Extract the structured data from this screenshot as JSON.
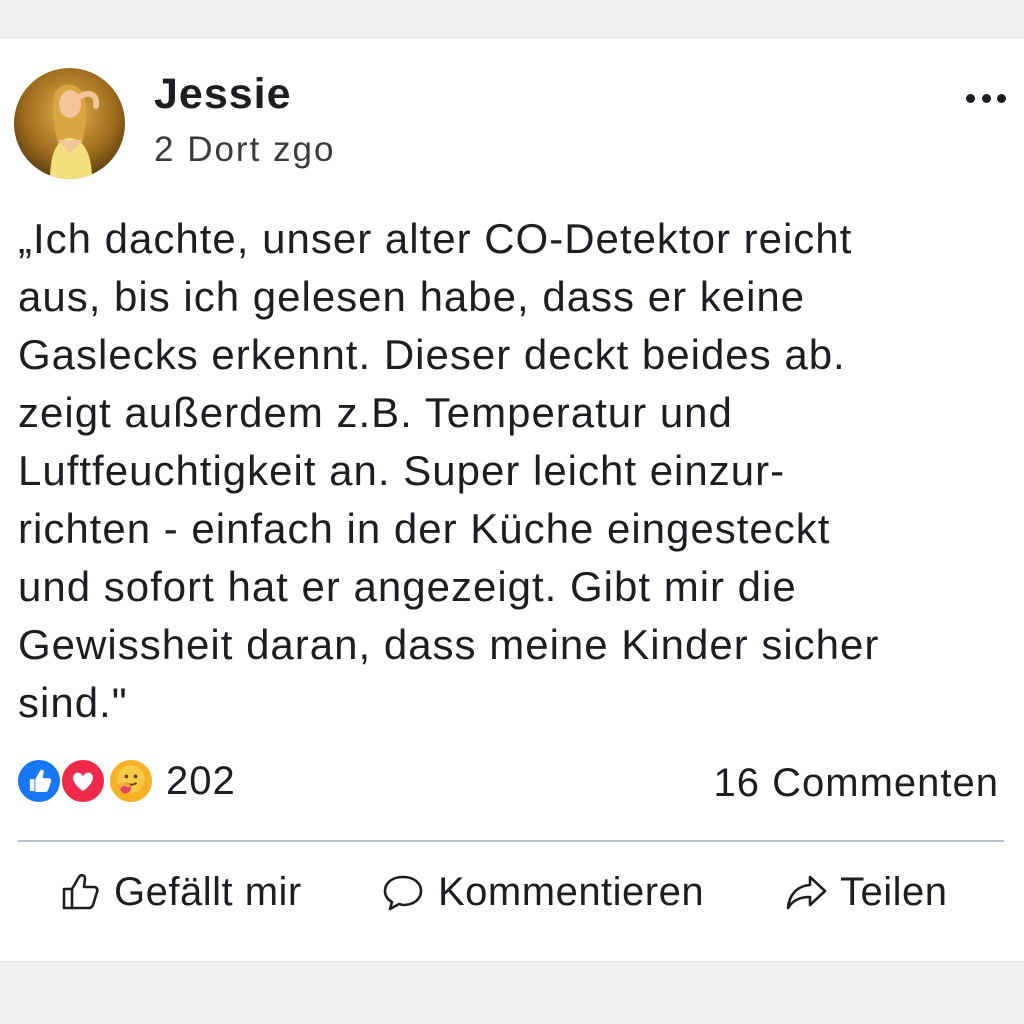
{
  "post": {
    "author": "Jessie",
    "timestamp": "2 Dort zgo",
    "text": "„Ich dachte, unser alter CO-Detektor reicht\naus, bis ich gelesen habe, dass er keine\nGaslecks erkennt. Dieser deckt beides ab.\nzeigt außerdem z.B. Temperatur und\nLuftfeuchtigkeit an. Super leicht einzur-\nrichten - einfach in der Küche eingesteckt\nund sofort hat er angezeigt. Gibt mir die\nGewissheit daran, dass meine Kinder sicher\nsind.\""
  },
  "reactions": {
    "icons": [
      "like-icon",
      "love-icon",
      "care-icon"
    ],
    "count": "202"
  },
  "comments": {
    "label": "16 Commenten"
  },
  "actions": {
    "like_label": "Gefällt mir",
    "comment_label": "Kommentieren",
    "share_label": "Teilen"
  },
  "colors": {
    "like_blue": "#1877f2",
    "love_red": "#f02849",
    "care_yellow": "#f7b125",
    "text": "#1c1e21",
    "divider": "#b9c3cf"
  }
}
